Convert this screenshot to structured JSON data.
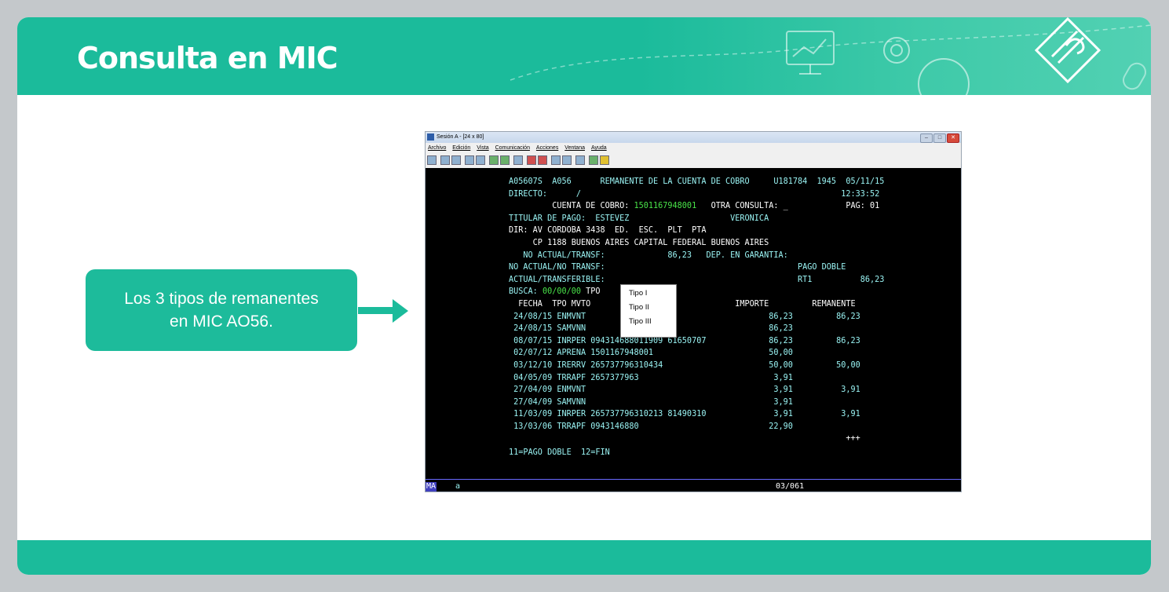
{
  "slide": {
    "title": "Consulta en MIC"
  },
  "callout": {
    "line1": "Los 3 tipos de remanentes",
    "line2": "en MIC AO56."
  },
  "window": {
    "title": "Sesión A - [24 x 80]",
    "menu": [
      "Archivo",
      "Edición",
      "Vista",
      "Comunicación",
      "Acciones",
      "Ventana",
      "Ayuda"
    ],
    "buttons": {
      "minimize": "–",
      "maximize": "□",
      "close": "✕"
    }
  },
  "terminal": {
    "line1": "A05607S  A056      REMANENTE DE LA CUENTA DE COBRO     U181784  1945  05/11/15",
    "line2": "DIRECTO:      /                                                      12:33:52",
    "line3a": "         CUENTA DE COBRO: ",
    "account": "1501167948001",
    "line3b": "   OTRA CONSULTA: _            PAG: 01",
    "line4": "TITULAR DE PAGO:  ESTEVEZ                     VERONICA",
    "line5": "DIR: AV CORDOBA 3438  ED.  ESC.  PLT  PTA",
    "line6": "     CP 1188 BUENOS AIRES CAPITAL FEDERAL BUENOS AIRES",
    "line7": "   NO ACTUAL/TRANSF:             86,23   DEP. EN GARANTIA:",
    "line8": "NO ACTUAL/NO TRANSF:                                        PAGO DOBLE",
    "line9": "ACTUAL/TRANSFERIBLE:                                        RT1          86,23",
    "line10a": "BUSCA: ",
    "busca_date": "00/00/00",
    "line10b": " TPO",
    "header_row": "  FECHA  TPO MVTO       REFERENCIA             IMPORTE         REMANENTE",
    "rows": [
      " 24/08/15 ENMVNT                                      86,23         86,23",
      " 24/08/15 SAMVNN                                      86,23",
      " 08/07/15 INRPER 094314688011909 61650707             86,23         86,23",
      " 02/07/12 APRENA 1501167948001                        50,00",
      " 03/12/10 IRERRV 265737796310434                      50,00         50,00",
      " 04/05/09 TRRAPF 2657377963                            3,91",
      " 27/04/09 ENMVNT                                       3,91          3,91",
      " 27/04/09 SAMVNN                                       3,91",
      " 11/03/09 INRPER 265737796310213 81490310              3,91          3,91",
      " 13/03/06 TRRAPF 0943146880                           22,90"
    ],
    "more": "                                                                      +++",
    "footer_keys": "11=PAGO DOBLE  12=FIN"
  },
  "popup": {
    "items": [
      "Tipo I",
      "Tipo II",
      "Tipo III"
    ]
  },
  "statusbar": {
    "mode": "MA",
    "session": "a",
    "position": "03/061"
  },
  "colors": {
    "accent": "#1bbb9b",
    "terminal_text": "#9af4f4",
    "terminal_bg": "#000000"
  }
}
